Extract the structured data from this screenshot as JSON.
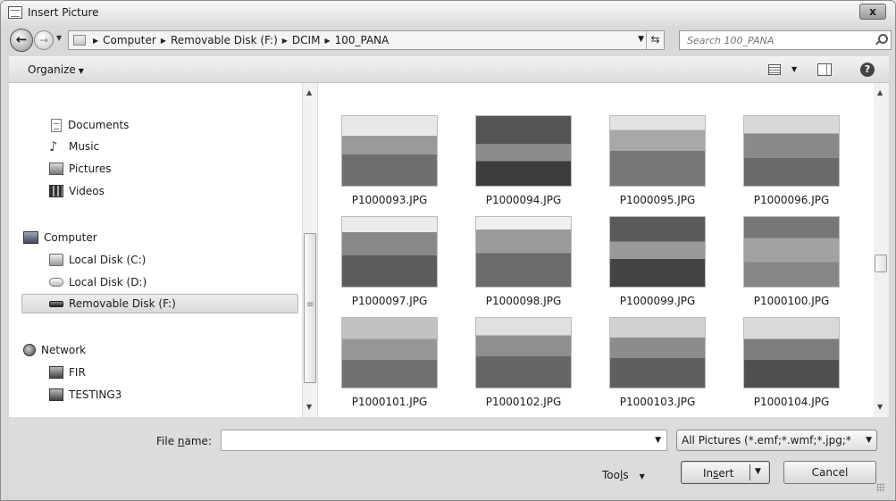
{
  "window": {
    "title": "Insert Picture",
    "close_label": "x"
  },
  "address": {
    "crumbs": [
      "Computer",
      "Removable Disk (F:)",
      "DCIM",
      "100_PANA"
    ]
  },
  "search": {
    "placeholder": "Search 100_PANA"
  },
  "toolbar": {
    "organize_label": "Organize"
  },
  "nav": {
    "items": [
      {
        "label": "Documents",
        "icon": "documents-icon"
      },
      {
        "label": "Music",
        "icon": "music-icon"
      },
      {
        "label": "Pictures",
        "icon": "pictures-icon"
      },
      {
        "label": "Videos",
        "icon": "videos-icon"
      },
      {
        "label": "Computer",
        "icon": "computer-icon"
      },
      {
        "label": "Local Disk (C:)",
        "icon": "hard-disk-icon"
      },
      {
        "label": "Local Disk (D:)",
        "icon": "hard-disk-icon"
      },
      {
        "label": "Removable Disk (F:)",
        "icon": "removable-disk-icon",
        "selected": true
      },
      {
        "label": "Network",
        "icon": "network-icon"
      },
      {
        "label": "FIR",
        "icon": "network-computer-icon"
      },
      {
        "label": "TESTING3",
        "icon": "network-computer-icon"
      }
    ]
  },
  "files": [
    {
      "name": "P1000093.JPG"
    },
    {
      "name": "P1000094.JPG"
    },
    {
      "name": "P1000095.JPG"
    },
    {
      "name": "P1000096.JPG"
    },
    {
      "name": "P1000097.JPG"
    },
    {
      "name": "P1000098.JPG"
    },
    {
      "name": "P1000099.JPG"
    },
    {
      "name": "P1000100.JPG"
    },
    {
      "name": "P1000101.JPG"
    },
    {
      "name": "P1000102.JPG"
    },
    {
      "name": "P1000103.JPG"
    },
    {
      "name": "P1000104.JPG"
    }
  ],
  "footer": {
    "filename_label_pre": "File ",
    "filename_label_u": "n",
    "filename_label_post": "ame:",
    "filename_value": "",
    "filetype_value": "All Pictures (*.emf;*.wmf;*.jpg;*",
    "tools_label_pre": "Too",
    "tools_label_u": "l",
    "tools_label_post": "s",
    "insert_label_pre": "In",
    "insert_label_u": "s",
    "insert_label_post": "ert",
    "cancel_label": "Cancel"
  }
}
